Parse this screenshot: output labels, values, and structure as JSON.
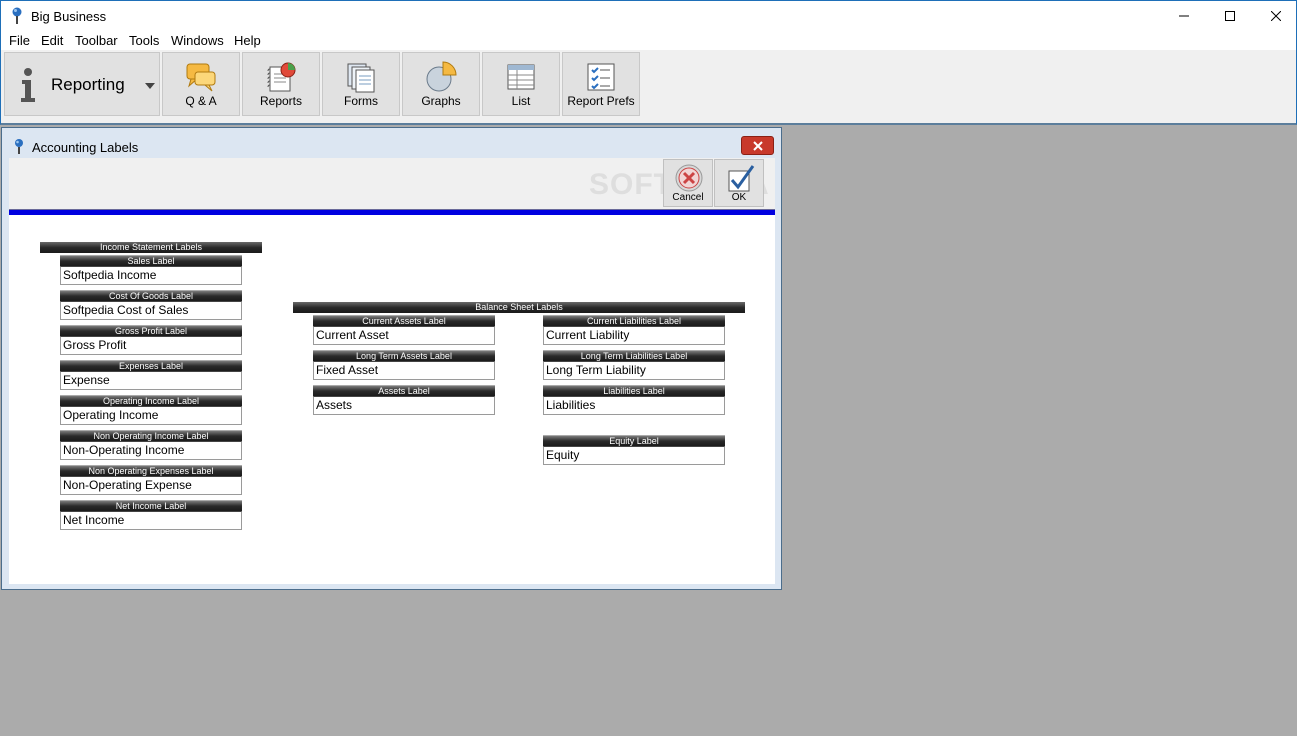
{
  "window": {
    "title": "Big Business"
  },
  "menu": [
    "File",
    "Edit",
    "Toolbar",
    "Tools",
    "Windows",
    "Help"
  ],
  "toolbar": {
    "mode_label": "Reporting",
    "buttons": [
      "Q & A",
      "Reports",
      "Forms",
      "Graphs",
      "List",
      "Report Prefs"
    ]
  },
  "dialog": {
    "title": "Accounting Labels",
    "cancel_label": "Cancel",
    "ok_label": "OK",
    "watermark": "SOFTPEDIA",
    "income_header": "Income Statement Labels",
    "income_fields": [
      {
        "label": "Sales Label",
        "value": "Softpedia Income"
      },
      {
        "label": "Cost Of Goods Label",
        "value": "Softpedia Cost of Sales"
      },
      {
        "label": "Gross Profit Label",
        "value": "Gross Profit"
      },
      {
        "label": "Expenses Label",
        "value": "Expense"
      },
      {
        "label": "Operating Income Label",
        "value": "Operating Income"
      },
      {
        "label": "Non Operating Income Label",
        "value": "Non-Operating Income"
      },
      {
        "label": "Non Operating Expenses Label",
        "value": "Non-Operating Expense"
      },
      {
        "label": "Net Income Label",
        "value": "Net Income"
      }
    ],
    "balance_header": "Balance Sheet Labels",
    "assets_fields": [
      {
        "label": "Current Assets Label",
        "value": "Current Asset"
      },
      {
        "label": "Long Term Assets Label",
        "value": "Fixed Asset"
      },
      {
        "label": "Assets Label",
        "value": "Assets"
      }
    ],
    "liabilities_fields": [
      {
        "label": "Current Liabilities Label",
        "value": "Current Liability"
      },
      {
        "label": "Long Term Liabilities Label",
        "value": "Long Term Liability"
      },
      {
        "label": "Liabilities Label",
        "value": "Liabilities"
      }
    ],
    "equity_field": {
      "label": "Equity Label",
      "value": "Equity"
    }
  }
}
